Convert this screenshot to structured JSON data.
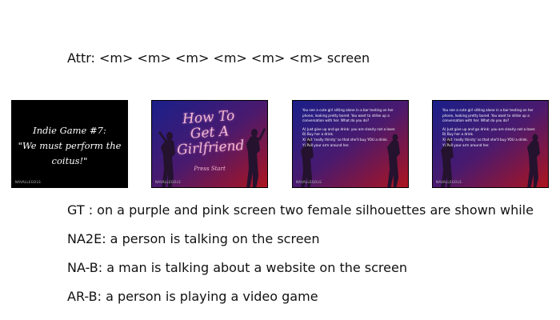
{
  "attr_line": "Attr: <m> <m> <m> <m> <m> <m> screen",
  "frames": {
    "frame1": {
      "line1": "Indie Game #7:",
      "line2": "\"We must perform the",
      "line3": "coitus!\"",
      "watermark": "NAVALLEGOLS"
    },
    "frame2": {
      "title": "How To Get A Girlfriend",
      "subtitle": "Press Start",
      "watermark": "NAVALLEGOLS"
    },
    "frame3": {
      "question": "You see a cute girl sitting alone in a bar texting on her phone, looking pretty bored. You want to strike up a conversation with her. What do you do?",
      "options": [
        "A) Just give up and go drink: you are clearly not a loser.",
        "B) Buy her a drink.",
        "X) Act 'really thirsty' so that she'll buy YOU a drink.",
        "Y) Pull your arm around her."
      ],
      "watermark": "NAVALLEGOLS"
    },
    "frame4": {
      "question": "You see a cute girl sitting alone in a bar texting on her phone, looking pretty bored. You want to strike up a conversation with her. What do you do?",
      "options": [
        "A) Just give up and go drink: you are clearly not a loser.",
        "B) Buy her a drink.",
        "X) Act 'really thirsty' so that she'll buy YOU a drink.",
        "Y) Pull your arm around her."
      ],
      "watermark": "NAVALLEGOLS"
    }
  },
  "captions": {
    "gt": "GT  : on a purple and pink screen two female silhouettes are shown while",
    "na2e": "NA2E: a person is talking on the screen",
    "na_b": "NA-B: a man is talking about a website on the screen",
    "ar_b": "AR-B: a person is playing a video game"
  },
  "colors": {
    "gradient_blue": "#1a1f8a",
    "gradient_purple": "#4a1a6e",
    "gradient_red": "#b0141c",
    "silhouette": "#24122e"
  }
}
